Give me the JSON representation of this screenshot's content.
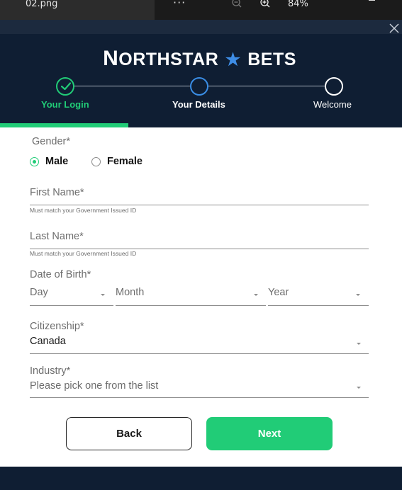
{
  "viewer": {
    "filename": "02.png",
    "menu_dots": "···",
    "zoom": "84%"
  },
  "brand": {
    "logo_part1": "N",
    "logo_part2": "ORTHSTAR",
    "logo_part3": "BETS",
    "star_glyph": "★",
    "accent": "#21cc77",
    "star_color": "#3e8de6"
  },
  "stepper": {
    "steps": [
      {
        "label": "Your Login",
        "status": "complete"
      },
      {
        "label": "Your Details",
        "status": "current"
      },
      {
        "label": "Welcome",
        "status": "upcoming"
      }
    ],
    "progress": 0.32
  },
  "form": {
    "gender": {
      "label": "Gender*",
      "options": [
        "Male",
        "Female"
      ],
      "selected": "Male"
    },
    "first_name": {
      "placeholder": "First Name*",
      "helper": "Must match your Government Issued ID"
    },
    "last_name": {
      "placeholder": "Last Name*",
      "helper": "Must match your Government Issued ID"
    },
    "dob": {
      "label": "Date of Birth*",
      "day": "Day",
      "month": "Month",
      "year": "Year"
    },
    "citizenship": {
      "label": "Citizenship*",
      "value": "Canada"
    },
    "industry": {
      "label": "Industry*",
      "placeholder": "Please pick one from the list"
    }
  },
  "buttons": {
    "back": "Back",
    "next": "Next"
  }
}
